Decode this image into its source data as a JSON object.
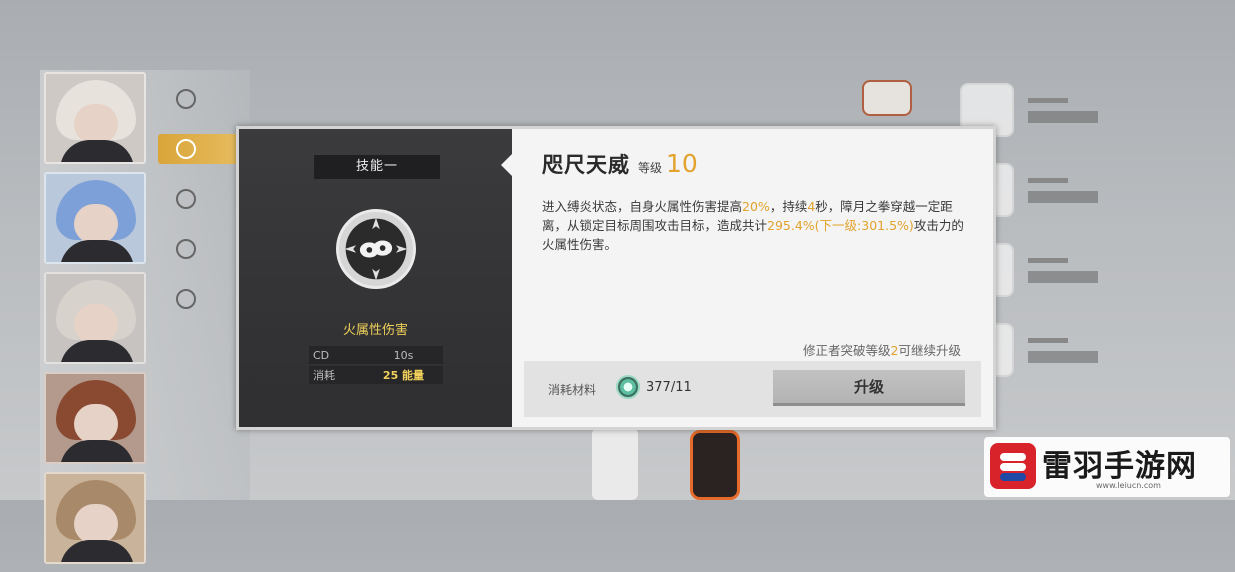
{
  "skill_panel": {
    "tab_label": "技能一",
    "damage_type": "火属性伤害",
    "stats": [
      {
        "key": "CD",
        "value": "10s"
      },
      {
        "key": "消耗",
        "value": "25 能量"
      }
    ]
  },
  "skill_detail": {
    "name": "咫尺天威",
    "level_label": "等级",
    "level_value": "10",
    "description_parts": {
      "p1": "进入缚炎状态，自身火属性伤害提高",
      "p1_hl": "20%",
      "p2": "，持续",
      "p2_hl": "4",
      "p3": "秒，障月之拳穿越一定距离，从锁定目标周围攻击目标，造成共计",
      "p3_hl": "295.4%(下一级:301.5%)",
      "p4": "攻击力的火属性伤害。"
    },
    "upgrade_note_pre": "修正者突破等级",
    "upgrade_note_hl": "2",
    "upgrade_note_post": "可继续升级",
    "material_label": "消耗材料",
    "material_count": "377/11",
    "upgrade_button": "升级"
  },
  "watermark": {
    "brand": "雷羽手游网",
    "url": "www.leiucn.com"
  },
  "colors": {
    "accent": "#e2a22d",
    "damage_text": "#f0d05a",
    "left_pane": "#343436",
    "right_pane": "#f4f4f4",
    "brand_red": "#d8232a"
  },
  "icons": {
    "skill_icon": "fist-emblem-icon",
    "material_icon": "crystal-material-icon",
    "brand_logo": "leiyu-logo-icon"
  }
}
